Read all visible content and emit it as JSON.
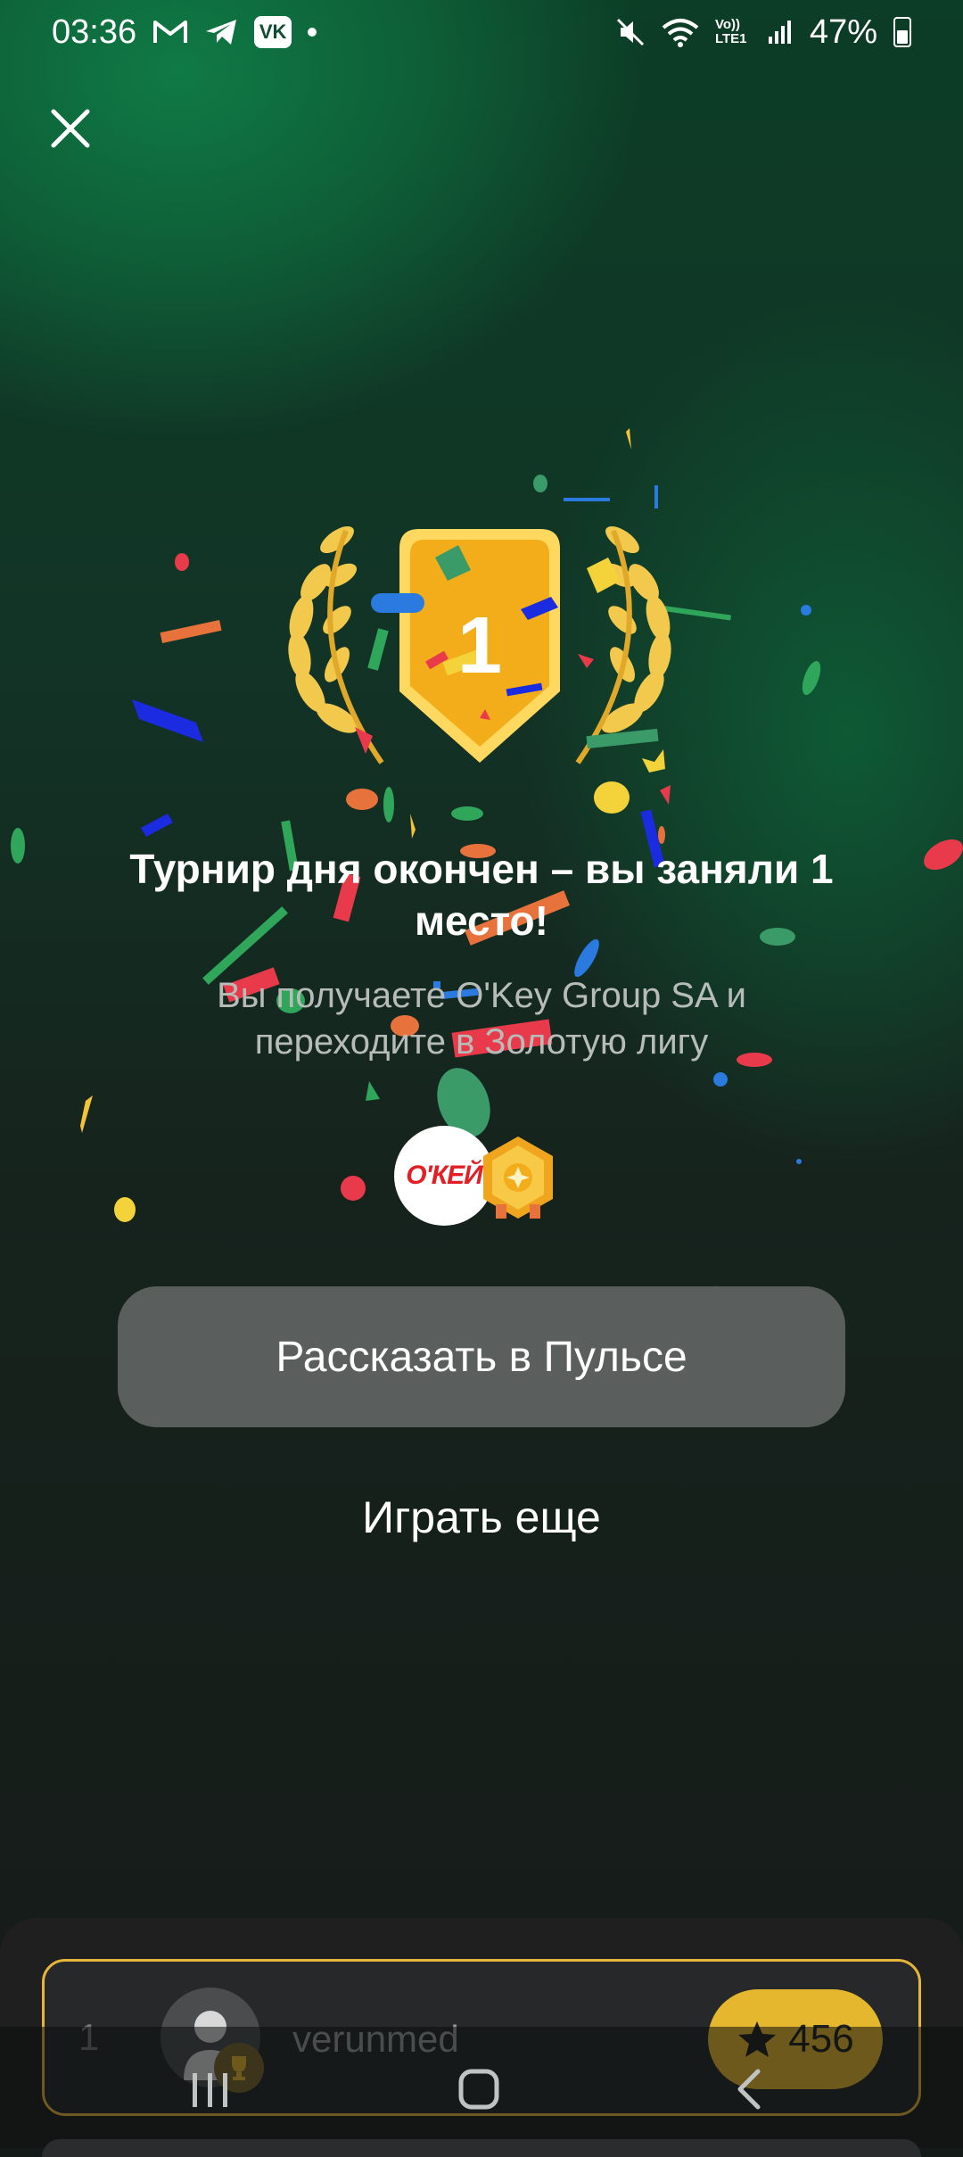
{
  "status_bar": {
    "time": "03:36",
    "left_icons": [
      "gmail-icon",
      "telegram-icon",
      "vk-icon",
      "notification-dot"
    ],
    "vk_label": "VK",
    "right_icons": [
      "mute-icon",
      "wifi-icon",
      "volte-icon",
      "signal-icon",
      "battery-icon"
    ],
    "volte_label": "Vo)) LTE1",
    "battery": "47%"
  },
  "result": {
    "place": "1",
    "title": "Турнир дня окончен – вы заняли 1 место!",
    "subtitle": "Вы получаете O'Key Group SA и переходите в Золотую лигу",
    "prize_logo_text": "О'КЕЙ",
    "league_badge": "gold-league-icon"
  },
  "actions": {
    "share_label": "Рассказать в Пульсе",
    "play_again_label": "Играть еще"
  },
  "leaderboard": {
    "rank": "1",
    "username": "verunmed",
    "score": "456"
  },
  "colors": {
    "accent_gold": "#e4b72f",
    "button_gray": "#5a5e5c",
    "okey_red": "#e31e24"
  }
}
